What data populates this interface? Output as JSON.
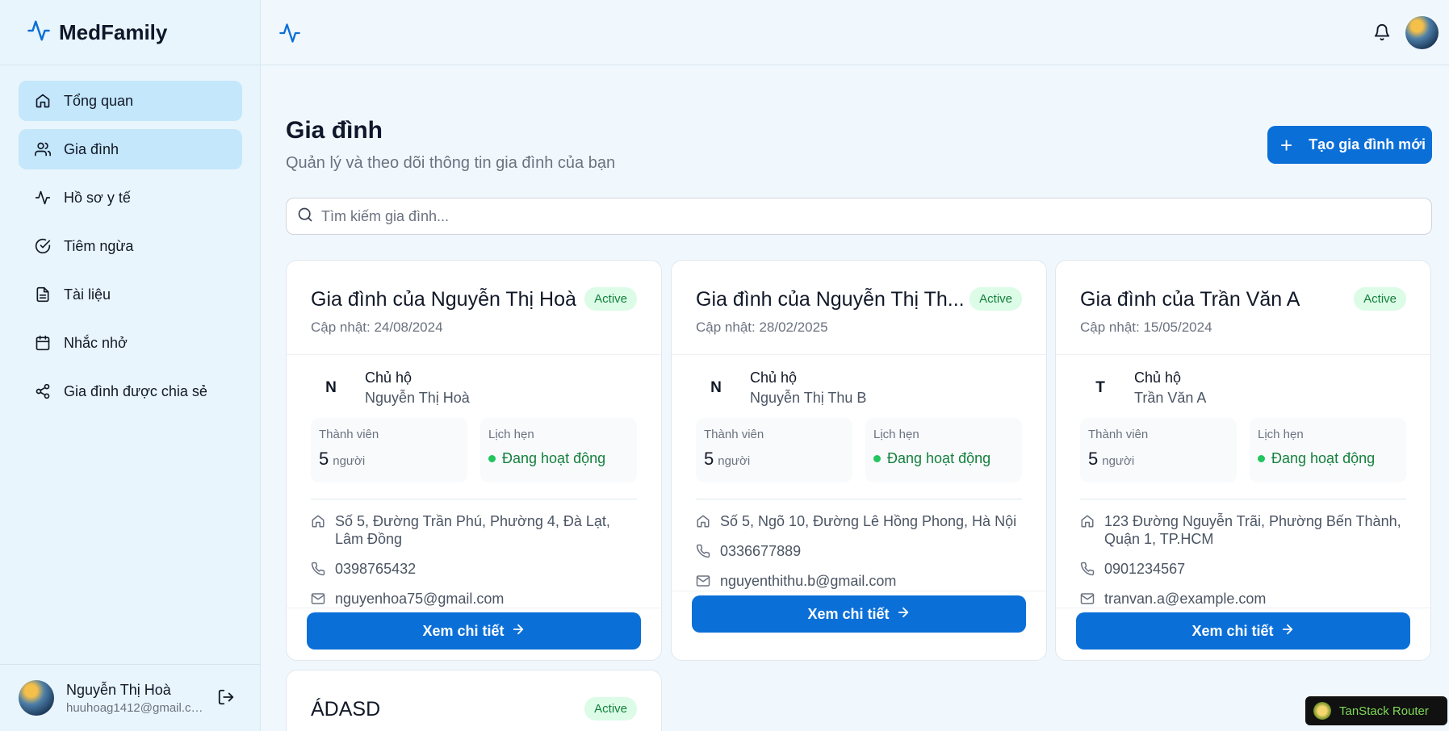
{
  "app": {
    "name": "MedFamily"
  },
  "sidebar": {
    "items": [
      {
        "label": "Tổng quan",
        "icon": "home-icon"
      },
      {
        "label": "Gia đình",
        "icon": "users-icon"
      },
      {
        "label": "Hồ sơ y tế",
        "icon": "activity-icon"
      },
      {
        "label": "Tiêm ngừa",
        "icon": "check-circle-icon"
      },
      {
        "label": "Tài liệu",
        "icon": "file-icon"
      },
      {
        "label": "Nhắc nhở",
        "icon": "calendar-icon"
      },
      {
        "label": "Gia đình được chia sẻ",
        "icon": "share-icon"
      }
    ],
    "user": {
      "name": "Nguyễn Thị Hoà",
      "email": "huuhoag1412@gmail.co..."
    }
  },
  "header": {
    "bell_icon": "bell-icon"
  },
  "page": {
    "title": "Gia đình",
    "subtitle": "Quản lý và theo dõi thông tin gia đình của bạn",
    "create_button": "Tạo gia đình mới",
    "search_placeholder": "Tìm kiếm gia đình..."
  },
  "labels": {
    "owner": "Chủ hộ",
    "members": "Thành viên",
    "unit": "người",
    "appointments": "Lịch hẹn",
    "active_status": "Đang hoạt động",
    "detail_button": "Xem chi tiết"
  },
  "families": [
    {
      "title": "Gia đình của Nguyễn Thị Hoà",
      "status": "Active",
      "updated": "Cập nhật: 24/08/2024",
      "initial": "N",
      "owner": "Nguyễn Thị Hoà",
      "members": "5",
      "address": "Số 5, Đường Trần Phú, Phường 4, Đà Lạt, Lâm Đồng",
      "phone": "0398765432",
      "email": "nguyenhoa75@gmail.com"
    },
    {
      "title": "Gia đình của Nguyễn Thị Th...",
      "status": "Active",
      "updated": "Cập nhật: 28/02/2025",
      "initial": "N",
      "owner": "Nguyễn Thị Thu B",
      "members": "5",
      "address": "Số 5, Ngõ 10, Đường Lê Hồng Phong, Hà Nội",
      "phone": "0336677889",
      "email": "nguyenthithu.b@gmail.com"
    },
    {
      "title": "Gia đình của Trần Văn A",
      "status": "Active",
      "updated": "Cập nhật: 15/05/2024",
      "initial": "T",
      "owner": "Trần Văn A",
      "members": "5",
      "address": "123 Đường Nguyễn Trãi, Phường Bến Thành, Quận 1, TP.HCM",
      "phone": "0901234567",
      "email": "tranvan.a@example.com"
    },
    {
      "title": "ÁDASD",
      "status": "Active"
    }
  ],
  "devtools": {
    "label": "TanStack Router"
  },
  "colors": {
    "primary": "#0b6fd8",
    "active_nav": "#c4e7fb",
    "badge_bg": "#dcfce7",
    "badge_text": "#15803d",
    "status_dot": "#22c55e"
  }
}
